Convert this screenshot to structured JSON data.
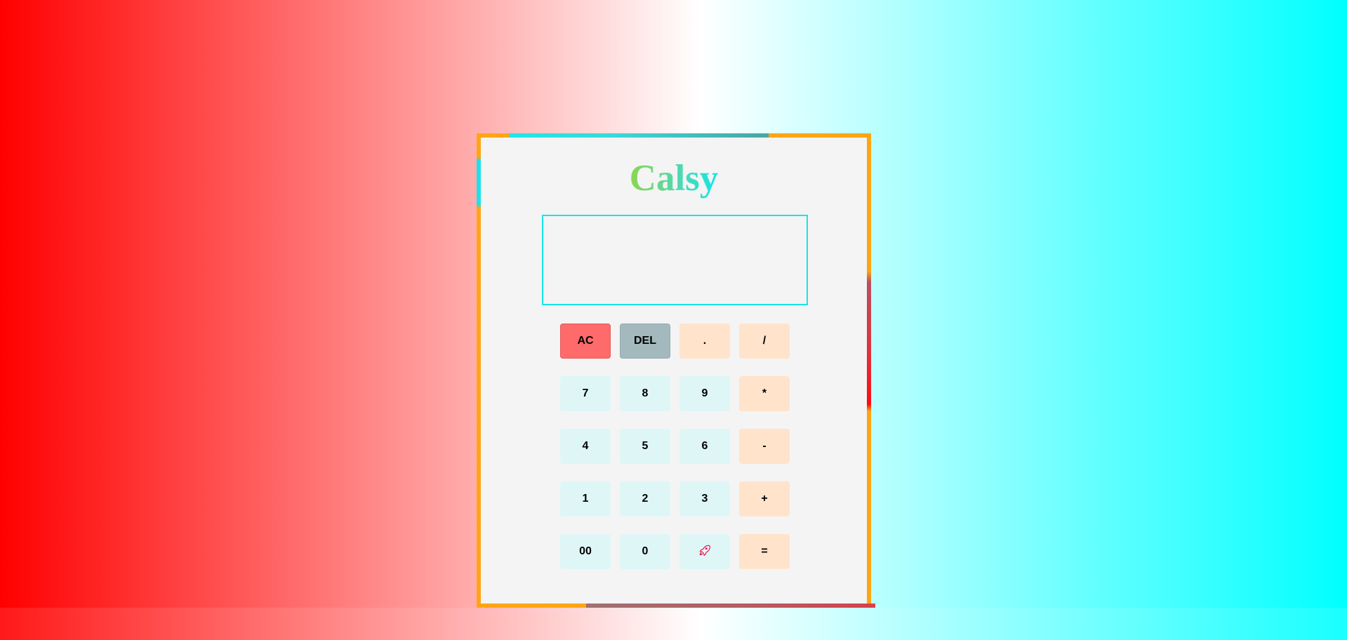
{
  "app": {
    "title": "Calsy"
  },
  "display": {
    "value": ""
  },
  "keys": [
    {
      "label": "AC",
      "kind": "ac",
      "name": "all-clear-button"
    },
    {
      "label": "DEL",
      "kind": "del",
      "name": "delete-button"
    },
    {
      "label": ".",
      "kind": "op",
      "name": "decimal-button"
    },
    {
      "label": "/",
      "kind": "op",
      "name": "divide-button"
    },
    {
      "label": "7",
      "kind": "num",
      "name": "digit-7-button"
    },
    {
      "label": "8",
      "kind": "num",
      "name": "digit-8-button"
    },
    {
      "label": "9",
      "kind": "num",
      "name": "digit-9-button"
    },
    {
      "label": "*",
      "kind": "op",
      "name": "multiply-button"
    },
    {
      "label": "4",
      "kind": "num",
      "name": "digit-4-button"
    },
    {
      "label": "5",
      "kind": "num",
      "name": "digit-5-button"
    },
    {
      "label": "6",
      "kind": "num",
      "name": "digit-6-button"
    },
    {
      "label": "-",
      "kind": "op",
      "name": "subtract-button"
    },
    {
      "label": "1",
      "kind": "num",
      "name": "digit-1-button"
    },
    {
      "label": "2",
      "kind": "num",
      "name": "digit-2-button"
    },
    {
      "label": "3",
      "kind": "num",
      "name": "digit-3-button"
    },
    {
      "label": "+",
      "kind": "op",
      "name": "add-button"
    },
    {
      "label": "00",
      "kind": "num",
      "name": "double-zero-button"
    },
    {
      "label": "0",
      "kind": "num",
      "name": "digit-0-button"
    },
    {
      "label": "",
      "icon": "rocket-icon",
      "kind": "num",
      "name": "rocket-button"
    },
    {
      "label": "=",
      "kind": "op",
      "name": "equals-button"
    }
  ],
  "colors": {
    "frame": "#ffa514",
    "display_border": "#16e6e6",
    "ac": "#ff6b6b",
    "del": "#a4b9be",
    "operator": "#ffe3cb",
    "number": "#dff6f7"
  }
}
